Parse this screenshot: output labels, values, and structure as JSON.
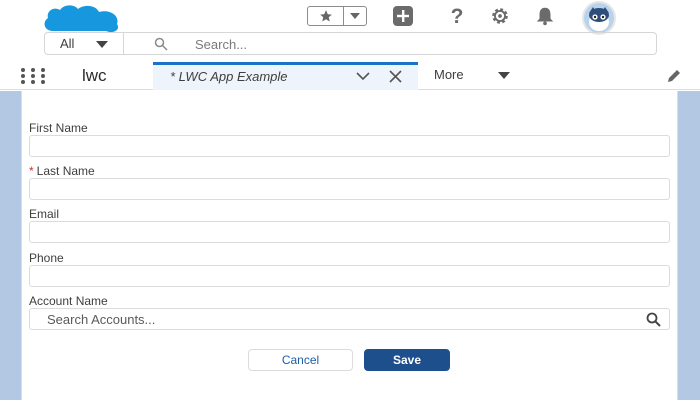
{
  "header": {
    "search_scope": "All",
    "search_placeholder": "Search..."
  },
  "nav": {
    "app_name": "lwc",
    "active_tab_label": "* LWC App Example",
    "more_label": "More"
  },
  "form": {
    "fields": [
      {
        "label": "First Name",
        "required": false,
        "value": ""
      },
      {
        "label": "Last Name",
        "required": true,
        "required_mark": "*",
        "value": ""
      },
      {
        "label": "Email",
        "required": false,
        "value": ""
      },
      {
        "label": "Phone",
        "required": false,
        "value": ""
      },
      {
        "label": "Account Name",
        "required": false,
        "placeholder": "Search Accounts..."
      }
    ],
    "cancel_label": "Cancel",
    "save_label": "Save"
  },
  "colors": {
    "brand_blue": "#1b73c9",
    "save_button": "#1c4f8c",
    "page_background": "#b3c8e2",
    "required_mark": "#c23934"
  },
  "icons": [
    "salesforce-cloud-logo",
    "favorites-star-icon",
    "plus-icon",
    "help-icon",
    "gear-icon",
    "bell-icon",
    "waffle-icon",
    "chevron-down-icon",
    "close-icon",
    "pencil-icon",
    "search-icon"
  ]
}
